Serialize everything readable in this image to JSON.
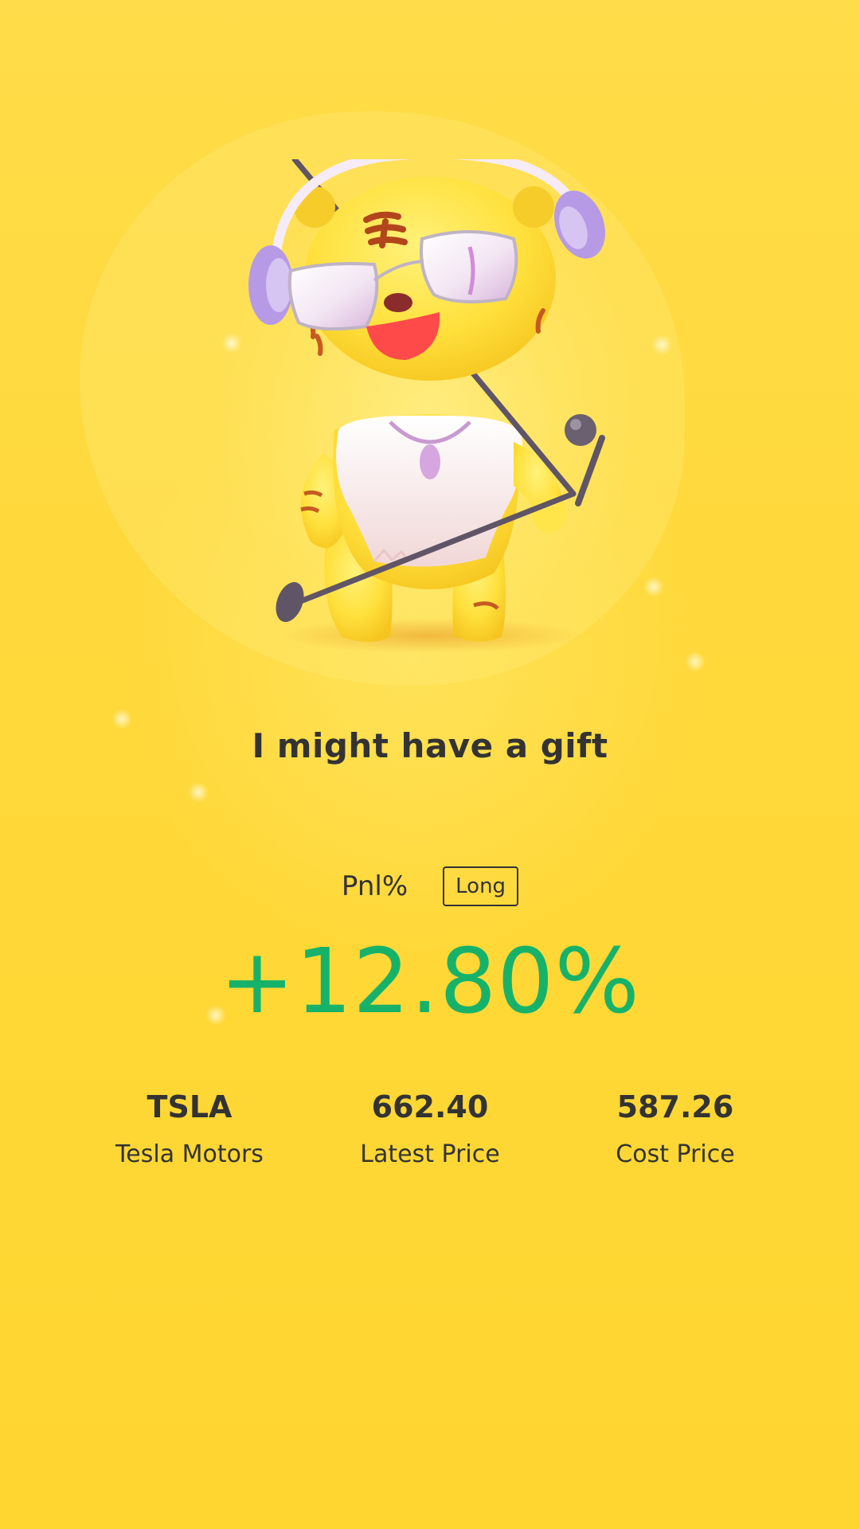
{
  "headline": "I might have a gift",
  "pnl": {
    "label": "Pnl%",
    "position_tag": "Long",
    "value": "+12.80%",
    "value_color": "#17b26a"
  },
  "stats": [
    {
      "value": "TSLA",
      "label": "Tesla Motors"
    },
    {
      "value": "662.40",
      "label": "Latest Price"
    },
    {
      "value": "587.26",
      "label": "Cost Price"
    }
  ],
  "background_color": "#ffd93c",
  "mascot": "tiger-dj-mascot-illustration"
}
